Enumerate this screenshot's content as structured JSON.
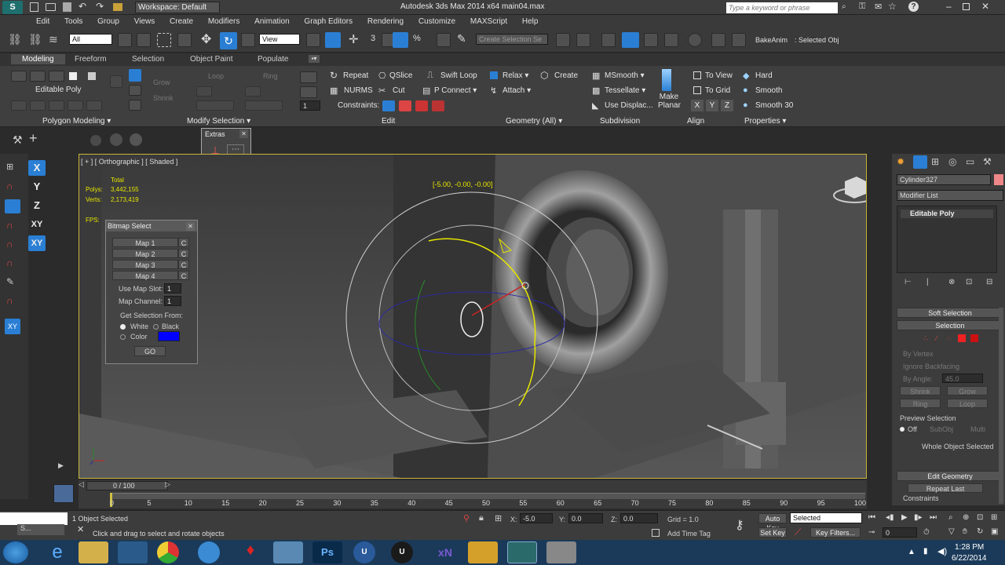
{
  "window": {
    "workspace_label": "Workspace: Default",
    "title": "Autodesk 3ds Max  2014 x64       main04.max",
    "search_placeholder": "Type a keyword or phrase"
  },
  "menu": [
    "Edit",
    "Tools",
    "Group",
    "Views",
    "Create",
    "Modifiers",
    "Animation",
    "Graph Editors",
    "Rendering",
    "Customize",
    "MAXScript",
    "Help"
  ],
  "toolbar": {
    "filter_value": "All",
    "refcoord_value": "View",
    "selection_set_placeholder": "Create Selection Se",
    "bake_label": "BakeAnim",
    "selected_obj_label": ": Selected Obj"
  },
  "ribbon_tabs": [
    "Modeling",
    "Freeform",
    "Selection",
    "Object Paint",
    "Populate"
  ],
  "ribbon": {
    "editable_poly": "Editable Poly",
    "polygon_modeling": "Polygon Modeling",
    "modify_selection": "Modify Selection",
    "grow": "Grow",
    "shrink": "Shrink",
    "loop": "Loop",
    "ring": "Ring",
    "repeat": "Repeat",
    "qslice": "QSlice",
    "swift_loop": "Swift Loop",
    "nurms": "NURMS",
    "cut": "Cut",
    "p_connect": "P Connect",
    "constraints": "Constraints:",
    "edit": "Edit",
    "relax": "Relax",
    "create": "Create",
    "attach": "Attach",
    "geometry_all": "Geometry (All)",
    "msmooth": "MSmooth",
    "tessellate": "Tessellate",
    "use_displac": "Use Displac...",
    "subdivision": "Subdivision",
    "make_planar": "Make Planar",
    "x": "X",
    "y": "Y",
    "z": "Z",
    "to_view": "To View",
    "to_grid": "To Grid",
    "align": "Align",
    "hard": "Hard",
    "smooth": "Smooth",
    "smooth30": "Smooth 30",
    "properties": "Properties"
  },
  "extras": {
    "title": "Extras"
  },
  "viewport": {
    "label": "[ + ] [ Orthographic ] [ Shaded ]",
    "total": "Total",
    "polys_label": "Polys:",
    "polys_value": "3,442,155",
    "verts_label": "Verts:",
    "verts_value": "2,173,419",
    "fps_label": "FPS:",
    "rotate_readout": "[-5.00, -0.00, -0.00]"
  },
  "axis_buttons": [
    "X",
    "Y",
    "Z",
    "XY",
    "XY",
    "XY"
  ],
  "bitmap_select": {
    "title": "Bitmap Select",
    "maps": [
      "Map 1",
      "Map 2",
      "Map 3",
      "Map 4"
    ],
    "clear": "C",
    "use_map_slot_label": "Use Map Slot:",
    "use_map_slot_value": "1",
    "map_channel_label": "Map Channel:",
    "map_channel_value": "1",
    "get_selection_from": "Get Selection From:",
    "white": "White",
    "black": "Black",
    "color": "Color",
    "swatch_color": "#0000ff",
    "go": "GO"
  },
  "command_panel": {
    "object_name": "Cylinder327",
    "modifier_list": "Modifier List",
    "stack_item": "Editable Poly",
    "soft_selection": "Soft Selection",
    "selection": "Selection",
    "by_vertex": "By Vertex",
    "ignore_backfacing": "Ignore Backfacing",
    "by_angle": "By Angle:",
    "by_angle_value": "45.0",
    "shrink": "Shrink",
    "grow": "Grow",
    "ring": "Ring",
    "loop": "Loop",
    "preview_selection": "Preview Selection",
    "off": "Off",
    "subobj": "SubObj",
    "multi": "Multi",
    "whole_object_selected": "Whole Object Selected",
    "edit_geometry": "Edit Geometry",
    "repeat_last": "Repeat Last",
    "constraints": "Constraints"
  },
  "timeline": {
    "frame_readout": "0 / 100",
    "ticks": [
      "0",
      "5",
      "10",
      "15",
      "20",
      "25",
      "30",
      "35",
      "40",
      "45",
      "50",
      "55",
      "60",
      "65",
      "70",
      "75",
      "80",
      "85",
      "90",
      "95",
      "100"
    ]
  },
  "status": {
    "selected_count": "1 Object Selected",
    "prompt": "Click and drag to select and rotate objects",
    "x_label": "X:",
    "x_value": "-5.0",
    "y_label": "Y:",
    "y_value": "0.0",
    "z_label": "Z:",
    "z_value": "0.0",
    "grid": "Grid = 1.0",
    "add_time_tag": "Add Time Tag",
    "auto_key": "Auto Key",
    "set_key": "Set Key",
    "selected_dropdown": "Selected",
    "key_filters": "Key Filters...",
    "frame_value": "0"
  },
  "taskbar": {
    "time": "1:28 PM",
    "date": "6/22/2014"
  },
  "colors": {
    "viewport_border": "#c8b43a",
    "accent_blue": "#2a7fd4",
    "gizmo_yellow": "#e6e600"
  }
}
